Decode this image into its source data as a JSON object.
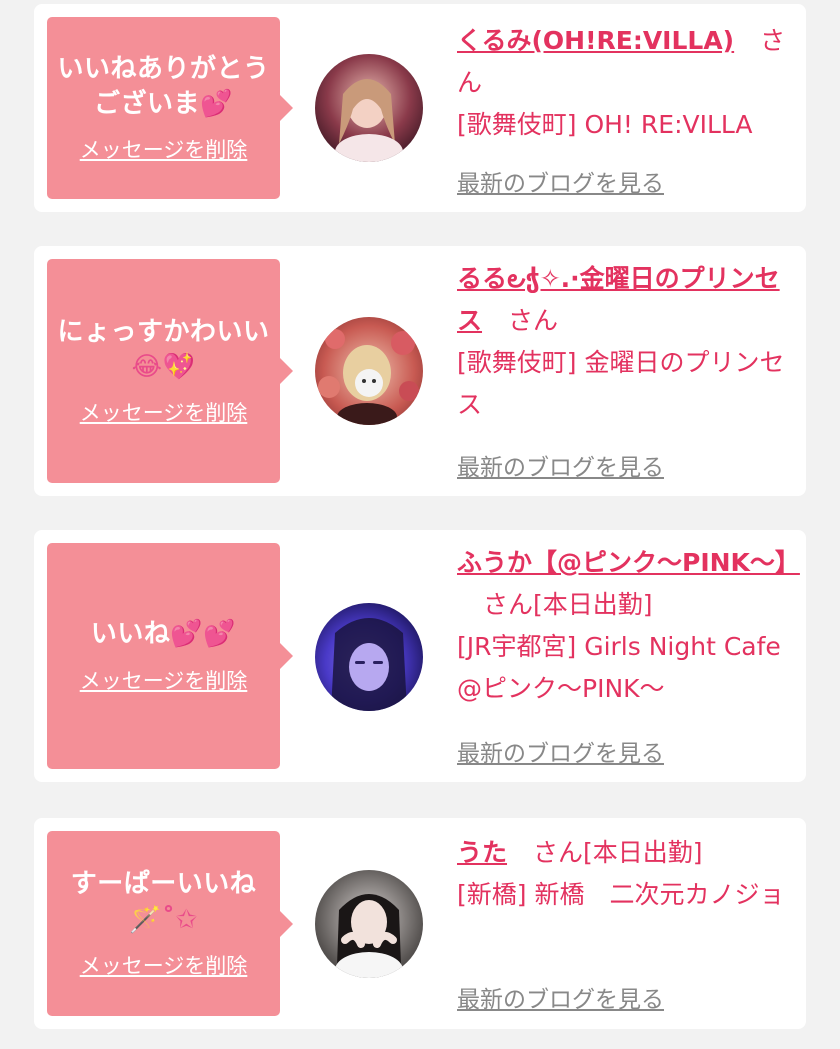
{
  "delete_label": "メッセージを削除",
  "blog_label": "最新のブログを見る",
  "honorific": "さん",
  "cards": [
    {
      "message_text": "いいねありがとうございま",
      "message_emoji": "💕",
      "name": "くるみ(OH!RE:VILLA)",
      "status": "",
      "shop": "[歌舞伎町] OH! RE:VILLA"
    },
    {
      "message_text": "にょっすかわいい",
      "message_emoji": "😂💖",
      "name": "るる౿ჭ✧.·金曜日のプリンセス",
      "status": "",
      "shop": "[歌舞伎町] 金曜日のプリンセス"
    },
    {
      "message_text": "いいね",
      "message_emoji": "💕💕",
      "name": "ふうか【@ピンク〜PINK〜】",
      "status": "[本日出勤]",
      "shop": "[JR宇都宮] Girls Night Cafe @ピンク〜PINK〜"
    },
    {
      "message_text": "すーぱーいいね",
      "message_emoji": "🪄˚✩",
      "name": "うた",
      "status": "[本日出勤]",
      "shop": "[新橋] 新橋　二次元カノジョ"
    }
  ],
  "colors": {
    "background": "#f2f2f2",
    "bubble": "#f48f97",
    "accent_text": "#e3325f",
    "blog_link": "#888888"
  }
}
